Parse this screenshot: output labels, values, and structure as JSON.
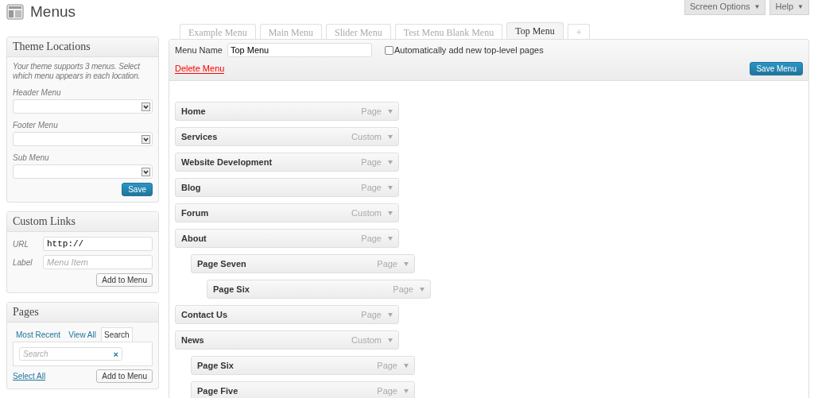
{
  "page_title": "Menus",
  "header_buttons": [
    {
      "label": "Screen Options",
      "caret": "▼"
    },
    {
      "label": "Help",
      "caret": "▼"
    }
  ],
  "theme_locations": {
    "title": "Theme Locations",
    "description": "Your theme supports 3 menus. Select which menu appears in each location.",
    "locations": [
      {
        "label": "Header Menu"
      },
      {
        "label": "Footer Menu"
      },
      {
        "label": "Sub Menu"
      }
    ],
    "save_button": "Save"
  },
  "custom_links": {
    "title": "Custom Links",
    "url_label": "URL",
    "url_value": "http://",
    "label_label": "Label",
    "label_placeholder": "Menu Item",
    "add_button": "Add to Menu"
  },
  "pages": {
    "title": "Pages",
    "tabs": [
      {
        "label": "Most Recent",
        "selected": false
      },
      {
        "label": "View All",
        "selected": false
      },
      {
        "label": "Search",
        "selected": true
      }
    ],
    "search_placeholder": "Search",
    "clear": "×",
    "select_all": "Select All",
    "add_button": "Add to Menu"
  },
  "menu_tabs": [
    {
      "label": "Example Menu",
      "selected": false
    },
    {
      "label": "Main Menu",
      "selected": false
    },
    {
      "label": "Slider Menu",
      "selected": false
    },
    {
      "label": "Test Menu Blank Menu",
      "selected": false
    },
    {
      "label": "Top Menu",
      "selected": true
    },
    {
      "label": "+",
      "selected": false
    }
  ],
  "menu_editor": {
    "name_label": "Menu Name",
    "name_value": "Top Menu",
    "auto_add_label": "Automatically add new top-level pages",
    "auto_add_checked": false,
    "delete_link": "Delete Menu",
    "save_button": "Save Menu",
    "items": [
      {
        "title": "Home",
        "type": "Page"
      },
      {
        "title": "Services",
        "type": "Custom"
      },
      {
        "title": "Website Development",
        "type": "Page"
      },
      {
        "title": "Blog",
        "type": "Page"
      },
      {
        "title": "Forum",
        "type": "Custom"
      },
      {
        "title": "About",
        "type": "Page",
        "children": [
          {
            "title": "Page Seven",
            "type": "Page",
            "children": [
              {
                "title": "Page Six",
                "type": "Page"
              }
            ]
          }
        ]
      },
      {
        "title": "Contact Us",
        "type": "Page"
      },
      {
        "title": "News",
        "type": "Custom",
        "children": [
          {
            "title": "Page Six",
            "type": "Page"
          },
          {
            "title": "Page Five",
            "type": "Page"
          }
        ]
      }
    ]
  }
}
